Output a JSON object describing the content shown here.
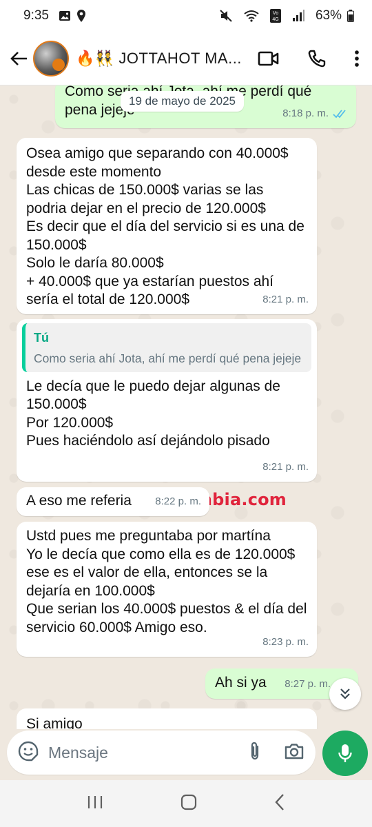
{
  "status_bar": {
    "time": "9:35",
    "battery": "63%",
    "network_label": "Voj 4G"
  },
  "header": {
    "title": "🔥👯 JOTTAHOT MA..."
  },
  "date_separator": "19 de mayo de 2025",
  "messages": [
    {
      "direction": "out",
      "text": "Como seria ahí Jota, ahí me perdí qué pena jejeje",
      "time": "8:18 p. m.",
      "read": true
    },
    {
      "direction": "in",
      "text": "Osea amigo que separando con 40.000$ desde este momento\nLas chicas de 150.000$ varias se las podria dejar en el precio de 120.000$\nEs decir que el día del servicio si es una de 150.000$\nSolo le daría 80.000$\n+ 40.000$ que ya estarían puestos ahí sería el total de 120.000$",
      "time": "8:21 p. m."
    },
    {
      "direction": "in",
      "quote_author": "Tú",
      "quote_text": "Como seria ahí Jota, ahí me perdí qué pena jejeje",
      "text": "Le decía que le puedo dejar algunas de 150.000$\nPor 120.000$\nPues haciéndolo así dejándolo pisado",
      "time": "8:21 p. m."
    },
    {
      "direction": "in",
      "text": "A eso me referia",
      "time": "8:22 p. m."
    },
    {
      "direction": "in",
      "text": "Ustd pues me preguntaba por martína\nYo le decía que como ella es de 120.000$ ese es el valor de ella, entonces se la dejaría en 100.000$\nQue serian los 40.000$ puestos & el día del servicio 60.000$ Amigo eso.",
      "time": "8:23 p. m."
    },
    {
      "direction": "out",
      "text": "Ah si ya",
      "time": "8:27 p. m.",
      "read": true
    },
    {
      "direction": "in",
      "text": "Si amigo",
      "time": ""
    }
  ],
  "watermark": "donColombia.com",
  "composer": {
    "placeholder": "Mensaje"
  },
  "colors": {
    "outgoing_bubble": "#d9fdd3",
    "incoming_bubble": "#ffffff",
    "accent_green": "#1daa61",
    "read_ticks": "#53bdeb",
    "watermark": "#e0243c"
  }
}
